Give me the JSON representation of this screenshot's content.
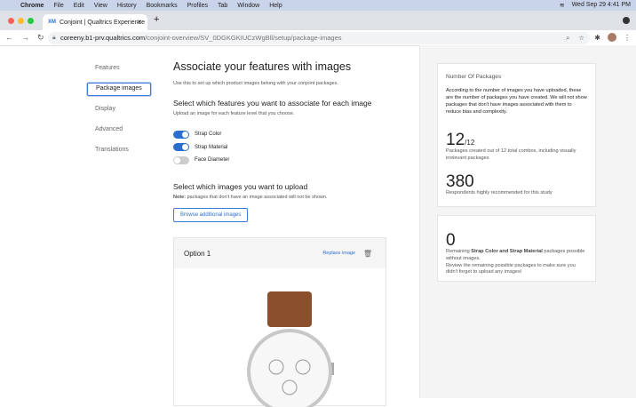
{
  "menubar": {
    "app": "Chrome",
    "items": [
      "File",
      "Edit",
      "View",
      "History",
      "Bookmarks",
      "Profiles",
      "Tab",
      "Window",
      "Help"
    ],
    "clock": "Wed Sep 29  4:41 PM"
  },
  "browser": {
    "tab_title": "Conjoint | Qualtrics Experience",
    "url_host": "coreeny.b1-prv.qualtrics.com",
    "url_path": "/conjoint-overview/SV_0DGKGKIUCzWgBll/setup/package-images"
  },
  "sidebar": {
    "items": [
      {
        "label": "Features"
      },
      {
        "label": "Package images"
      },
      {
        "label": "Display"
      },
      {
        "label": "Advanced"
      },
      {
        "label": "Translations"
      }
    ]
  },
  "main": {
    "title": "Associate your features with images",
    "subtitle": "Use this to set up which product images belong with your conjoint packages.",
    "features_heading": "Select which features you want to associate for each image",
    "features_sub": "Upload an image for each feature level that you choose.",
    "toggles": [
      {
        "label": "Strap Color",
        "on": true
      },
      {
        "label": "Strap Material",
        "on": true
      },
      {
        "label": "Face Diameter",
        "on": false
      }
    ],
    "upload_heading": "Select which images you want to upload",
    "note_label": "Note:",
    "note_text": " packages that don't have an image associated will not be shown.",
    "browse_button": "Browse additional images",
    "option_title": "Option 1",
    "replace_link": "Replace image"
  },
  "summary": {
    "title": "Number Of Packages",
    "desc": "According to the number of images you have uploaded, these are the number of packages you have created. We will not show packages that don't have images associated with them to reduce bias and complexity.",
    "packages": "12",
    "packages_total": "/12",
    "packages_caption": "Packages created out of 12 total combos, including visually irrelevant packages",
    "respondents": "380",
    "respondents_caption": "Respondents highly recommended for this study",
    "remaining": "0",
    "remaining_pre": "Remaining ",
    "remaining_bold": "Strap Color and Strap Material",
    "remaining_post": " packages possible without images.",
    "remaining_note": "Review the remaining possible packages to make sure you didn't forget to upload any images!"
  }
}
